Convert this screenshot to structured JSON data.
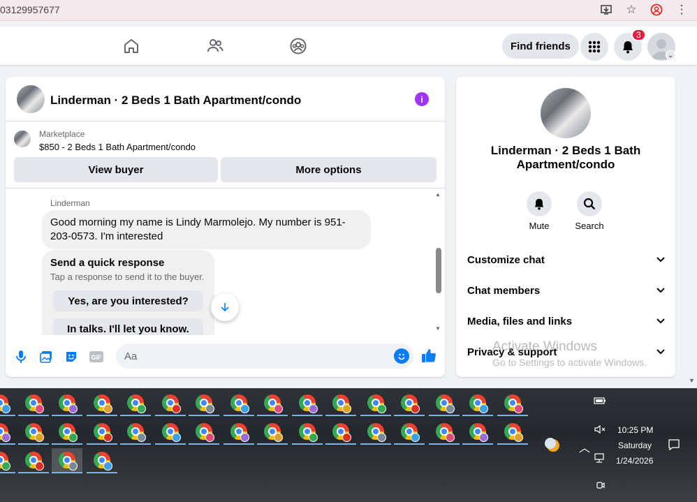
{
  "browser": {
    "url": "03129957677",
    "icons": [
      "install-icon",
      "star-icon",
      "profile-icon",
      "menu-icon"
    ]
  },
  "header": {
    "find_friends": "Find friends",
    "notification_count": "3"
  },
  "chat": {
    "title": "Linderman · 2 Beds 1 Bath Apartment/condo",
    "marketplace_label": "Marketplace",
    "listing": "$850 - 2 Beds 1 Bath Apartment/condo",
    "view_buyer": "View buyer",
    "more_options": "More options",
    "sender": "Linderman",
    "message": "Good morning my name is Lindy Marmolejo. My number is 951-203-0573. I'm interested",
    "quick_title": "Send a quick response",
    "quick_sub": "Tap a response to send it to the buyer.",
    "quick_opt_1": "Yes, are you interested?",
    "quick_opt_2": "In talks. I'll let you know.",
    "input_placeholder": "Aa"
  },
  "info_panel": {
    "title": "Linderman · 2 Beds 1 Bath Apartment/condo",
    "mute": "Mute",
    "search": "Search",
    "rows": [
      "Customize chat",
      "Chat members",
      "Media, files and links",
      "Privacy & support"
    ]
  },
  "watermark": {
    "line1": "Activate Windows",
    "line2": "Go to Settings to activate Windows."
  },
  "taskbar": {
    "time": "10:25 PM",
    "day": "Saturday",
    "date": "1/24/2026"
  },
  "colors": {
    "accent": "#0a7cff",
    "info_purple": "#a033ff",
    "badge_red": "#e41e3f"
  }
}
